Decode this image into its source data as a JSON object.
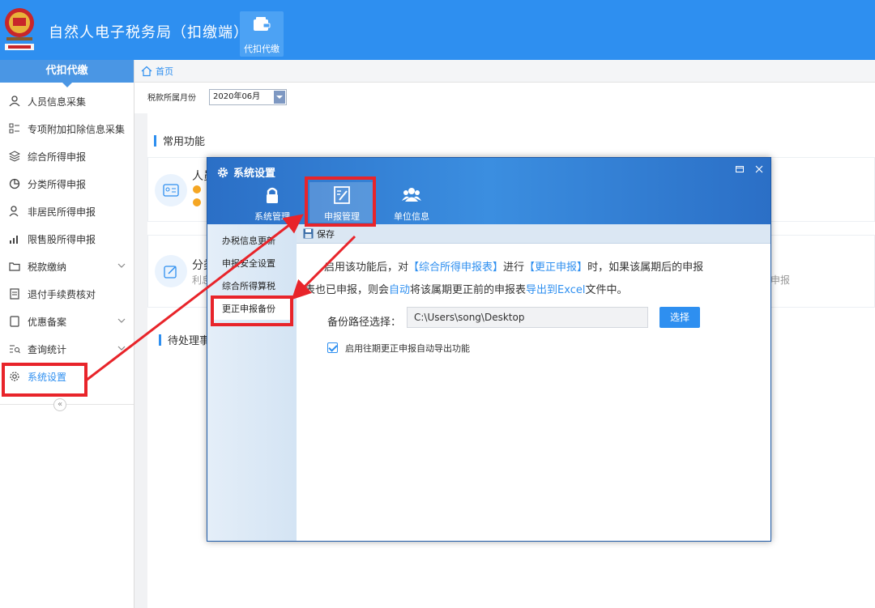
{
  "header": {
    "title": "自然人电子税务局（扣缴端）",
    "nav": [
      {
        "label": "代扣代缴"
      }
    ]
  },
  "sidebar": {
    "heading": "代扣代缴",
    "items": [
      {
        "label": "人员信息采集",
        "icon": "user-icon"
      },
      {
        "label": "专项附加扣除信息采集",
        "icon": "list-icon"
      },
      {
        "label": "综合所得申报",
        "icon": "layers-icon"
      },
      {
        "label": "分类所得申报",
        "icon": "pie-icon"
      },
      {
        "label": "非居民所得申报",
        "icon": "person-icon"
      },
      {
        "label": "限售股所得申报",
        "icon": "bar-chart-icon"
      },
      {
        "label": "税款缴纳",
        "icon": "folder-icon",
        "expandable": true
      },
      {
        "label": "退付手续费核对",
        "icon": "receipt-icon"
      },
      {
        "label": "优惠备案",
        "icon": "file-icon",
        "expandable": true
      },
      {
        "label": "查询统计",
        "icon": "search-list-icon",
        "expandable": true
      },
      {
        "label": "系统设置",
        "icon": "gear-icon",
        "active": true
      }
    ],
    "collapse_glyph": "«"
  },
  "breadcrumb": {
    "home": "首页"
  },
  "filter": {
    "label": "税款所属月份",
    "month": "2020年06月"
  },
  "content": {
    "common_title": "常用功能",
    "pending_title": "待处理事",
    "card1": {
      "title": "人员"
    },
    "card2": {
      "title": "分类",
      "sub": "利息",
      "right_sub": "申报"
    }
  },
  "dialog": {
    "title": "系统设置",
    "tabs": [
      {
        "label": "系统管理",
        "icon": "lock-icon"
      },
      {
        "label": "申报管理",
        "icon": "edit-doc-icon",
        "active": true
      },
      {
        "label": "单位信息",
        "icon": "group-icon"
      }
    ],
    "left_menu": [
      {
        "label": "办税信息更新"
      },
      {
        "label": "申报安全设置"
      },
      {
        "label": "综合所得算税"
      },
      {
        "label": "更正申报备份",
        "active": true
      }
    ],
    "toolbar_save": "保存",
    "desc": {
      "p1": "启用该功能后，对",
      "h1": "【综合所得申报表】",
      "p2": "进行",
      "h2": "【更正申报】",
      "p3": "时，如果该属期后的申报表也已申报，则会",
      "h3": "自动",
      "p4": "将该属期更正前的申报表",
      "h4": "导出到Excel",
      "p5": "文件中。"
    },
    "path_label": "备份路径选择：",
    "path_value": "C:\\Users\\song\\Desktop",
    "choose_button": "选择",
    "checkbox_label": "启用往期更正申报自动导出功能",
    "checkbox_checked": true
  },
  "colors": {
    "header": "#2e8ff0",
    "accent": "#2e8ff0",
    "highlight": "#e8242a"
  }
}
